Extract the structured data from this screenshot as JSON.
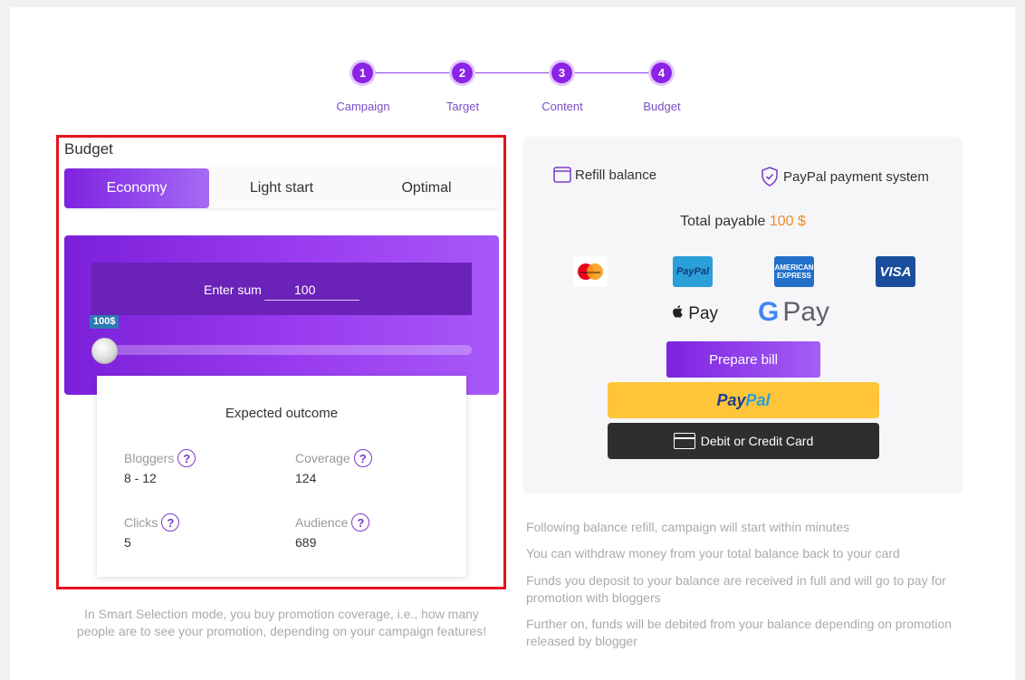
{
  "stepper": {
    "steps": [
      {
        "number": "1",
        "label": "Campaign"
      },
      {
        "number": "2",
        "label": "Target"
      },
      {
        "number": "3",
        "label": "Content"
      },
      {
        "number": "4",
        "label": "Budget"
      }
    ]
  },
  "budget": {
    "title": "Budget",
    "tabs": [
      "Economy",
      "Light start",
      "Optimal"
    ],
    "active_tab": "Economy",
    "sum_label": "Enter sum",
    "sum_value": "100",
    "slider_badge": "100$",
    "slider_level": 0,
    "outcome": {
      "title": "Expected outcome",
      "metrics": [
        {
          "label": "Bloggers",
          "value": "8 - 12"
        },
        {
          "label": "Coverage",
          "value": "124"
        },
        {
          "label": "Clicks",
          "value": "5"
        },
        {
          "label": "Audience",
          "value": "689"
        }
      ],
      "help_glyph": "?"
    },
    "note": "In Smart Selection mode, you buy promotion coverage, i.e., how many people are to see your promotion, depending on your campaign features!"
  },
  "payment": {
    "refill_label": "Refill balance",
    "paypal_system_label": "PayPal payment system",
    "total_label": "Total payable",
    "total_amount": "100 $",
    "logos": {
      "mastercard": "mastercard",
      "paypal": "PayPal",
      "amex_line1": "AMERICAN",
      "amex_line2": "EXPRESS",
      "visa": "VISA"
    },
    "apple_pay": " Pay",
    "google_pay_g": "G",
    "google_pay_text": "Pay",
    "prepare_button": "Prepare bill",
    "paypal_button_pay": "Pay",
    "paypal_button_pal": "Pal",
    "card_button": "Debit or Credit Card"
  },
  "info": [
    "Following balance refill, campaign will start within minutes",
    "You can withdraw money from your total balance back to your card",
    "Funds you deposit to your balance are received in full and will go to pay for promotion with bloggers",
    "Further on, funds will be debited from your balance depending on promotion released by blogger"
  ],
  "colors": {
    "accent": "#8b24e6",
    "highlight_border": "#e5131f",
    "total_amount": "#f08a24"
  }
}
